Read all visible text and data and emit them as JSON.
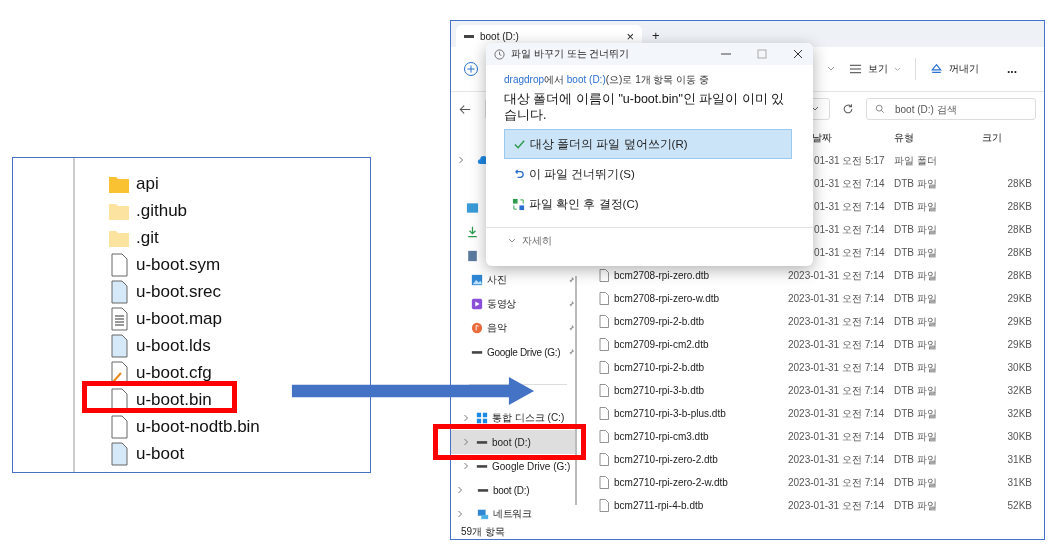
{
  "source_list": {
    "items": [
      {
        "name": "api",
        "kind": "folder"
      },
      {
        "name": ".github",
        "kind": "folder-hidden"
      },
      {
        "name": ".git",
        "kind": "folder-hidden"
      },
      {
        "name": "u-boot.sym",
        "kind": "file"
      },
      {
        "name": "u-boot.srec",
        "kind": "file-blue"
      },
      {
        "name": "u-boot.map",
        "kind": "text-file"
      },
      {
        "name": "u-boot.lds",
        "kind": "file-blue"
      },
      {
        "name": "u-boot.cfg",
        "kind": "config-file"
      },
      {
        "name": "u-boot.bin",
        "kind": "file"
      },
      {
        "name": "u-boot-nodtb.bin",
        "kind": "file"
      },
      {
        "name": "u-boot",
        "kind": "file-blue"
      }
    ]
  },
  "explorer": {
    "tab": {
      "title": "boot (D:)",
      "close": "×",
      "new": "+"
    },
    "toolbar": {
      "view": "보기",
      "eject": "꺼내기",
      "more": "..."
    },
    "search": {
      "placeholder": "boot (D:) 검색"
    },
    "columns": [
      "날짜",
      "유형",
      "크기"
    ],
    "rows": [
      {
        "date": "01-31 오전 5:17",
        "type": "파일 폴더"
      },
      {
        "date": "01-31 오전 7:14",
        "type": "DTB 파일",
        "size": "28KB"
      },
      {
        "date": "01-31 오전 7:14",
        "type": "DTB 파일",
        "size": "28KB"
      },
      {
        "date": "01-31 오전 7:14",
        "type": "DTB 파일",
        "size": "28KB"
      },
      {
        "date": "01-31 오전 7:14",
        "type": "DTB 파일",
        "size": "28KB"
      },
      {
        "name": "bcm2708-rpi-zero.dtb",
        "date": "2023-01-31 오전 7:14",
        "type": "DTB 파일",
        "size": "28KB"
      },
      {
        "name": "bcm2708-rpi-zero-w.dtb",
        "date": "2023-01-31 오전 7:14",
        "type": "DTB 파일",
        "size": "29KB"
      },
      {
        "name": "bcm2709-rpi-2-b.dtb",
        "date": "2023-01-31 오전 7:14",
        "type": "DTB 파일",
        "size": "29KB"
      },
      {
        "name": "bcm2709-rpi-cm2.dtb",
        "date": "2023-01-31 오전 7:14",
        "type": "DTB 파일",
        "size": "29KB"
      },
      {
        "name": "bcm2710-rpi-2-b.dtb",
        "date": "2023-01-31 오전 7:14",
        "type": "DTB 파일",
        "size": "30KB"
      },
      {
        "name": "bcm2710-rpi-3-b.dtb",
        "date": "2023-01-31 오전 7:14",
        "type": "DTB 파일",
        "size": "32KB"
      },
      {
        "name": "bcm2710-rpi-3-b-plus.dtb",
        "date": "2023-01-31 오전 7:14",
        "type": "DTB 파일",
        "size": "32KB"
      },
      {
        "name": "bcm2710-rpi-cm3.dtb",
        "date": "2023-01-31 오전 7:14",
        "type": "DTB 파일",
        "size": "30KB"
      },
      {
        "name": "bcm2710-rpi-zero-2.dtb",
        "date": "2023-01-31 오전 7:14",
        "type": "DTB 파일",
        "size": "31KB"
      },
      {
        "name": "bcm2710-rpi-zero-2-w.dtb",
        "date": "2023-01-31 오전 7:14",
        "type": "DTB 파일",
        "size": "31KB"
      },
      {
        "name": "bcm2711-rpi-4-b.dtb",
        "date": "2023-01-31 오전 7:14",
        "type": "DTB 파일",
        "size": "52KB"
      }
    ],
    "sidebar": {
      "quick_access": [
        {
          "label": "사진",
          "kind": "photos",
          "pinned": true
        },
        {
          "label": "동영상",
          "kind": "videos",
          "pinned": true
        },
        {
          "label": "음악",
          "kind": "music",
          "pinned": true
        },
        {
          "label": "Google Drive (G:)",
          "kind": "drive",
          "pinned": true
        }
      ],
      "drives": [
        {
          "label": "통합 디스크 (C:)",
          "kind": "disk",
          "selected": false
        },
        {
          "label": "boot (D:)",
          "kind": "drive",
          "selected": true
        },
        {
          "label": "Google Drive (G:)",
          "kind": "drive",
          "selected": false
        }
      ],
      "locations": [
        {
          "label": "boot (D:)",
          "kind": "drive"
        },
        {
          "label": "네트워크",
          "kind": "network"
        }
      ]
    },
    "status_bar": "59개 항목",
    "dialog": {
      "title": "파일 바꾸기 또는 건너뛰기",
      "source": "dragdrop",
      "destination": "boot (D:)",
      "subtitle_rest_1": "에서 ",
      "subtitle_rest_2": "(으)로 1개 항목 이동 중",
      "heading": "대상 폴더에 이름이 \"u-boot.bin\"인 파일이 이미 있습니다.",
      "options": [
        {
          "label": "대상 폴더의 파일 덮어쓰기(R)",
          "kind": "replace",
          "selected": true
        },
        {
          "label": "이 파일 건너뛰기(S)",
          "kind": "skip",
          "selected": false
        },
        {
          "label": "파일 확인 후 결정(C)",
          "kind": "compare",
          "selected": false
        }
      ],
      "details": "자세히"
    }
  }
}
